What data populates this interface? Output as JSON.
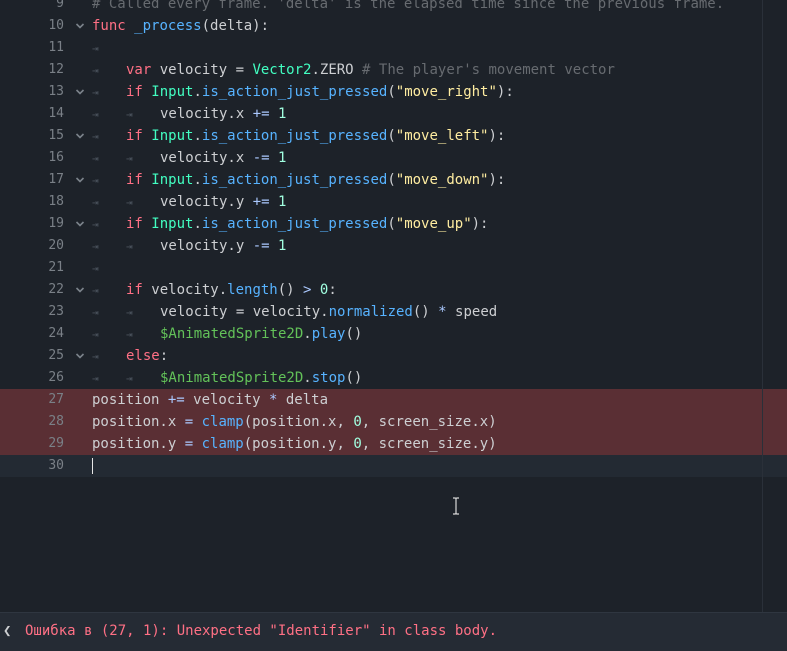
{
  "editor": {
    "lines": [
      {
        "n": "9",
        "fold": "",
        "indent": 0,
        "tokens": [
          {
            "t": "# Called every frame. 'delta' is the elapsed time since the previous frame.",
            "c": "cm"
          }
        ]
      },
      {
        "n": "10",
        "fold": "v",
        "indent": 0,
        "tokens": [
          {
            "t": "func",
            "c": "kw"
          },
          {
            "t": " "
          },
          {
            "t": "_process",
            "c": "fn"
          },
          {
            "t": "(delta):"
          }
        ]
      },
      {
        "n": "11",
        "fold": "",
        "indent": 1,
        "tokens": []
      },
      {
        "n": "12",
        "fold": "",
        "indent": 1,
        "tokens": [
          {
            "t": "var",
            "c": "kw"
          },
          {
            "t": " velocity = "
          },
          {
            "t": "Vector2",
            "c": "ty"
          },
          {
            "t": ".ZERO "
          },
          {
            "t": "# The player's movement vector",
            "c": "cm"
          }
        ]
      },
      {
        "n": "13",
        "fold": "v",
        "indent": 1,
        "tokens": [
          {
            "t": "if",
            "c": "kw"
          },
          {
            "t": " "
          },
          {
            "t": "Input",
            "c": "ty"
          },
          {
            "t": "."
          },
          {
            "t": "is_action_just_pressed",
            "c": "fn"
          },
          {
            "t": "("
          },
          {
            "t": "\"move_right\"",
            "c": "str"
          },
          {
            "t": "):"
          }
        ]
      },
      {
        "n": "14",
        "fold": "",
        "indent": 2,
        "tokens": [
          {
            "t": "velocity.x "
          },
          {
            "t": "+=",
            "c": "sym"
          },
          {
            "t": " "
          },
          {
            "t": "1",
            "c": "num"
          }
        ]
      },
      {
        "n": "15",
        "fold": "v",
        "indent": 1,
        "tokens": [
          {
            "t": "if",
            "c": "kw"
          },
          {
            "t": " "
          },
          {
            "t": "Input",
            "c": "ty"
          },
          {
            "t": "."
          },
          {
            "t": "is_action_just_pressed",
            "c": "fn"
          },
          {
            "t": "("
          },
          {
            "t": "\"move_left\"",
            "c": "str"
          },
          {
            "t": "):"
          }
        ]
      },
      {
        "n": "16",
        "fold": "",
        "indent": 2,
        "tokens": [
          {
            "t": "velocity.x "
          },
          {
            "t": "-=",
            "c": "sym"
          },
          {
            "t": " "
          },
          {
            "t": "1",
            "c": "num"
          }
        ]
      },
      {
        "n": "17",
        "fold": "v",
        "indent": 1,
        "tokens": [
          {
            "t": "if",
            "c": "kw"
          },
          {
            "t": " "
          },
          {
            "t": "Input",
            "c": "ty"
          },
          {
            "t": "."
          },
          {
            "t": "is_action_just_pressed",
            "c": "fn"
          },
          {
            "t": "("
          },
          {
            "t": "\"move_down\"",
            "c": "str"
          },
          {
            "t": "):"
          }
        ]
      },
      {
        "n": "18",
        "fold": "",
        "indent": 2,
        "tokens": [
          {
            "t": "velocity.y "
          },
          {
            "t": "+=",
            "c": "sym"
          },
          {
            "t": " "
          },
          {
            "t": "1",
            "c": "num"
          }
        ]
      },
      {
        "n": "19",
        "fold": "v",
        "indent": 1,
        "tokens": [
          {
            "t": "if",
            "c": "kw"
          },
          {
            "t": " "
          },
          {
            "t": "Input",
            "c": "ty"
          },
          {
            "t": "."
          },
          {
            "t": "is_action_just_pressed",
            "c": "fn"
          },
          {
            "t": "("
          },
          {
            "t": "\"move_up\"",
            "c": "str"
          },
          {
            "t": "):"
          }
        ]
      },
      {
        "n": "20",
        "fold": "",
        "indent": 2,
        "tokens": [
          {
            "t": "velocity.y "
          },
          {
            "t": "-=",
            "c": "sym"
          },
          {
            "t": " "
          },
          {
            "t": "1",
            "c": "num"
          }
        ]
      },
      {
        "n": "21",
        "fold": "",
        "indent": 1,
        "tokens": []
      },
      {
        "n": "22",
        "fold": "v",
        "indent": 1,
        "tokens": [
          {
            "t": "if",
            "c": "kw"
          },
          {
            "t": " velocity."
          },
          {
            "t": "length",
            "c": "fn"
          },
          {
            "t": "() "
          },
          {
            "t": ">",
            "c": "sym"
          },
          {
            "t": " "
          },
          {
            "t": "0",
            "c": "num"
          },
          {
            "t": ":"
          }
        ]
      },
      {
        "n": "23",
        "fold": "",
        "indent": 2,
        "tokens": [
          {
            "t": "velocity = velocity."
          },
          {
            "t": "normalized",
            "c": "fn"
          },
          {
            "t": "() "
          },
          {
            "t": "*",
            "c": "sym"
          },
          {
            "t": " speed"
          }
        ]
      },
      {
        "n": "24",
        "fold": "",
        "indent": 2,
        "tokens": [
          {
            "t": "$AnimatedSprite2D",
            "c": "node"
          },
          {
            "t": "."
          },
          {
            "t": "play",
            "c": "fn"
          },
          {
            "t": "()"
          }
        ]
      },
      {
        "n": "25",
        "fold": "v",
        "indent": 1,
        "tokens": [
          {
            "t": "else",
            "c": "kw"
          },
          {
            "t": ":"
          }
        ]
      },
      {
        "n": "26",
        "fold": "",
        "indent": 2,
        "tokens": [
          {
            "t": "$AnimatedSprite2D",
            "c": "node"
          },
          {
            "t": "."
          },
          {
            "t": "stop",
            "c": "fn"
          },
          {
            "t": "()"
          }
        ]
      },
      {
        "n": "27",
        "fold": "",
        "indent": 0,
        "error": true,
        "tokens": [
          {
            "t": "position "
          },
          {
            "t": "+=",
            "c": "sym"
          },
          {
            "t": " velocity "
          },
          {
            "t": "*",
            "c": "sym"
          },
          {
            "t": " delta"
          }
        ]
      },
      {
        "n": "28",
        "fold": "",
        "indent": 0,
        "error": true,
        "tokens": [
          {
            "t": "position.x "
          },
          {
            "t": "=",
            "c": "sym"
          },
          {
            "t": " "
          },
          {
            "t": "clamp",
            "c": "fn"
          },
          {
            "t": "(position.x, "
          },
          {
            "t": "0",
            "c": "num"
          },
          {
            "t": ", screen_size.x)"
          }
        ]
      },
      {
        "n": "29",
        "fold": "",
        "indent": 0,
        "error": true,
        "tokens": [
          {
            "t": "position.y "
          },
          {
            "t": "=",
            "c": "sym"
          },
          {
            "t": " "
          },
          {
            "t": "clamp",
            "c": "fn"
          },
          {
            "t": "(position.y, "
          },
          {
            "t": "0",
            "c": "num"
          },
          {
            "t": ", screen_size.y)"
          }
        ]
      },
      {
        "n": "30",
        "fold": "",
        "indent": 0,
        "current": true,
        "tokens": []
      }
    ]
  },
  "icons": {
    "fold": "chevron-down-icon",
    "tab": "tab-arrow-icon",
    "toggle": "chevron-left-icon"
  },
  "statusbar": {
    "toggle_glyph": "❮",
    "error_text": "Ошибка в (27, 1): Unexpected \"Identifier\" in class body."
  }
}
